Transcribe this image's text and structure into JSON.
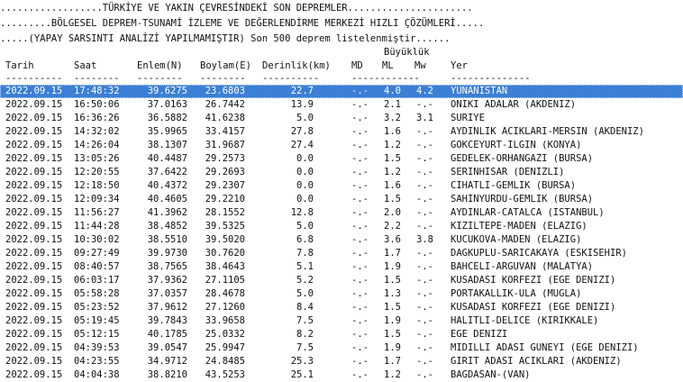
{
  "header": {
    "line1": "..................TÜRKİYE VE YAKIN ÇEVRESİNDEKİ SON DEPREMLER......................",
    "line2": ".........BÖLGESEL DEPREM-TSUNAMİ İZLEME VE DEĞERLENDİRME MERKEZİ HIZLI ÇÖZÜMLERİ.....",
    "line3": ".....(YAPAY SARSINTI ANALİZİ YAPILMAMIŞTIR) Son 500 deprem listelenmiştir......",
    "magnitude_group": "Büyüklük"
  },
  "columns": {
    "tarih": "Tarih",
    "saat": "Saat",
    "enlem": "Enlem(N)",
    "boylam": "Boylam(E)",
    "derinlik": "Derinlik(km)",
    "md": "MD",
    "ml": "ML",
    "mw": "Mw",
    "yer": "Yer"
  },
  "dashes": {
    "tarih": "----------",
    "saat": "--------",
    "enlem": "--------",
    "boylam": "--------",
    "derinlik": "----------",
    "mag": "------------",
    "yer": "--------------"
  },
  "rows": [
    {
      "date": "2022.09.15",
      "time": "17:48:32",
      "lat": "39.6275",
      "lon": "23.6803",
      "depth": "22.7",
      "md": "-.-",
      "ml": "4.0",
      "mw": "4.2",
      "place": "YUNANISTAN",
      "selected": true
    },
    {
      "date": "2022.09.15",
      "time": "16:50:06",
      "lat": "37.0163",
      "lon": "26.7442",
      "depth": "13.9",
      "md": "-.-",
      "ml": "2.1",
      "mw": "-.-",
      "place": "ONIKI ADALAR (AKDENIZ)"
    },
    {
      "date": "2022.09.15",
      "time": "16:36:26",
      "lat": "36.5882",
      "lon": "41.6238",
      "depth": "5.0",
      "md": "-.-",
      "ml": "3.2",
      "mw": "3.1",
      "place": "SURIYE"
    },
    {
      "date": "2022.09.15",
      "time": "14:32:02",
      "lat": "35.9965",
      "lon": "33.4157",
      "depth": "27.8",
      "md": "-.-",
      "ml": "1.6",
      "mw": "-.-",
      "place": "AYDINLIK ACIKLARI-MERSIN (AKDENIZ)"
    },
    {
      "date": "2022.09.15",
      "time": "14:26:04",
      "lat": "38.1307",
      "lon": "31.9687",
      "depth": "27.4",
      "md": "-.-",
      "ml": "1.2",
      "mw": "-.-",
      "place": "GOKCEYURT-ILGIN (KONYA)"
    },
    {
      "date": "2022.09.15",
      "time": "13:05:26",
      "lat": "40.4487",
      "lon": "29.2573",
      "depth": "0.0",
      "md": "-.-",
      "ml": "1.5",
      "mw": "-.-",
      "place": "GEDELEK-ORHANGAZI (BURSA)"
    },
    {
      "date": "2022.09.15",
      "time": "12:20:55",
      "lat": "37.6422",
      "lon": "29.2693",
      "depth": "0.0",
      "md": "-.-",
      "ml": "1.2",
      "mw": "-.-",
      "place": "SERINHISAR (DENIZLI)"
    },
    {
      "date": "2022.09.15",
      "time": "12:18:50",
      "lat": "40.4372",
      "lon": "29.2307",
      "depth": "0.0",
      "md": "-.-",
      "ml": "1.6",
      "mw": "-.-",
      "place": "CIHATLI-GEMLIK (BURSA)"
    },
    {
      "date": "2022.09.15",
      "time": "12:09:34",
      "lat": "40.4605",
      "lon": "29.2210",
      "depth": "0.0",
      "md": "-.-",
      "ml": "1.5",
      "mw": "-.-",
      "place": "SAHINYURDU-GEMLIK (BURSA)"
    },
    {
      "date": "2022.09.15",
      "time": "11:56:27",
      "lat": "41.3962",
      "lon": "28.1552",
      "depth": "12.8",
      "md": "-.-",
      "ml": "2.0",
      "mw": "-.-",
      "place": "AYDINLAR-CATALCA (ISTANBUL)"
    },
    {
      "date": "2022.09.15",
      "time": "11:44:28",
      "lat": "38.4852",
      "lon": "39.5325",
      "depth": "5.0",
      "md": "-.-",
      "ml": "2.2",
      "mw": "-.-",
      "place": "KIZILTEPE-MADEN (ELAZIG)"
    },
    {
      "date": "2022.09.15",
      "time": "10:30:02",
      "lat": "38.5510",
      "lon": "39.5020",
      "depth": "6.8",
      "md": "-.-",
      "ml": "3.6",
      "mw": "3.8",
      "place": "KUCUKOVA-MADEN (ELAZIG)"
    },
    {
      "date": "2022.09.15",
      "time": "09:27:49",
      "lat": "39.9730",
      "lon": "30.7620",
      "depth": "7.8",
      "md": "-.-",
      "ml": "1.7",
      "mw": "-.-",
      "place": "DAGKUPLU-SARICAKAYA (ESKISEHIR)"
    },
    {
      "date": "2022.09.15",
      "time": "08:40:57",
      "lat": "38.7565",
      "lon": "38.4643",
      "depth": "5.1",
      "md": "-.-",
      "ml": "1.9",
      "mw": "-.-",
      "place": "BAHCELI-ARGUVAN (MALATYA)"
    },
    {
      "date": "2022.09.15",
      "time": "06:03:17",
      "lat": "37.9362",
      "lon": "27.1105",
      "depth": "5.2",
      "md": "-.-",
      "ml": "1.5",
      "mw": "-.-",
      "place": "KUSADASI KORFEZI (EGE DENIZI)"
    },
    {
      "date": "2022.09.15",
      "time": "05:58:28",
      "lat": "37.0357",
      "lon": "28.4678",
      "depth": "5.0",
      "md": "-.-",
      "ml": "1.3",
      "mw": "-.-",
      "place": "PORTAKALLIK-ULA (MUGLA)"
    },
    {
      "date": "2022.09.15",
      "time": "05:23:52",
      "lat": "37.9612",
      "lon": "27.1260",
      "depth": "8.4",
      "md": "-.-",
      "ml": "1.5",
      "mw": "-.-",
      "place": "KUSADASI KORFEZI (EGE DENIZI)"
    },
    {
      "date": "2022.09.15",
      "time": "05:19:45",
      "lat": "39.7843",
      "lon": "33.9658",
      "depth": "7.5",
      "md": "-.-",
      "ml": "1.9",
      "mw": "-.-",
      "place": "HALITLI-DELICE (KIRIKKALE)"
    },
    {
      "date": "2022.09.15",
      "time": "05:12:15",
      "lat": "40.1785",
      "lon": "25.0332",
      "depth": "8.2",
      "md": "-.-",
      "ml": "1.5",
      "mw": "-.-",
      "place": "EGE DENIZI"
    },
    {
      "date": "2022.09.15",
      "time": "04:39:53",
      "lat": "39.0547",
      "lon": "25.9947",
      "depth": "7.5",
      "md": "-.-",
      "ml": "1.9",
      "mw": "-.-",
      "place": "MIDILLI ADASI GUNEYI (EGE DENIZI)"
    },
    {
      "date": "2022.09.15",
      "time": "04:23:55",
      "lat": "34.9712",
      "lon": "24.8485",
      "depth": "25.3",
      "md": "-.-",
      "ml": "1.7",
      "mw": "-.-",
      "place": "GIRIT ADASI ACIKLARI (AKDENIZ)"
    },
    {
      "date": "2022.09.15",
      "time": "04:04:38",
      "lat": "38.8210",
      "lon": "43.5253",
      "depth": "25.1",
      "md": "-.-",
      "ml": "1.2",
      "mw": "-.-",
      "place": "BAGDASAN-(VAN)"
    }
  ],
  "colors": {
    "selected_bg": "#3b7fd6",
    "selected_text": "#ffffff",
    "text": "#111111",
    "background": "#ffffff"
  }
}
